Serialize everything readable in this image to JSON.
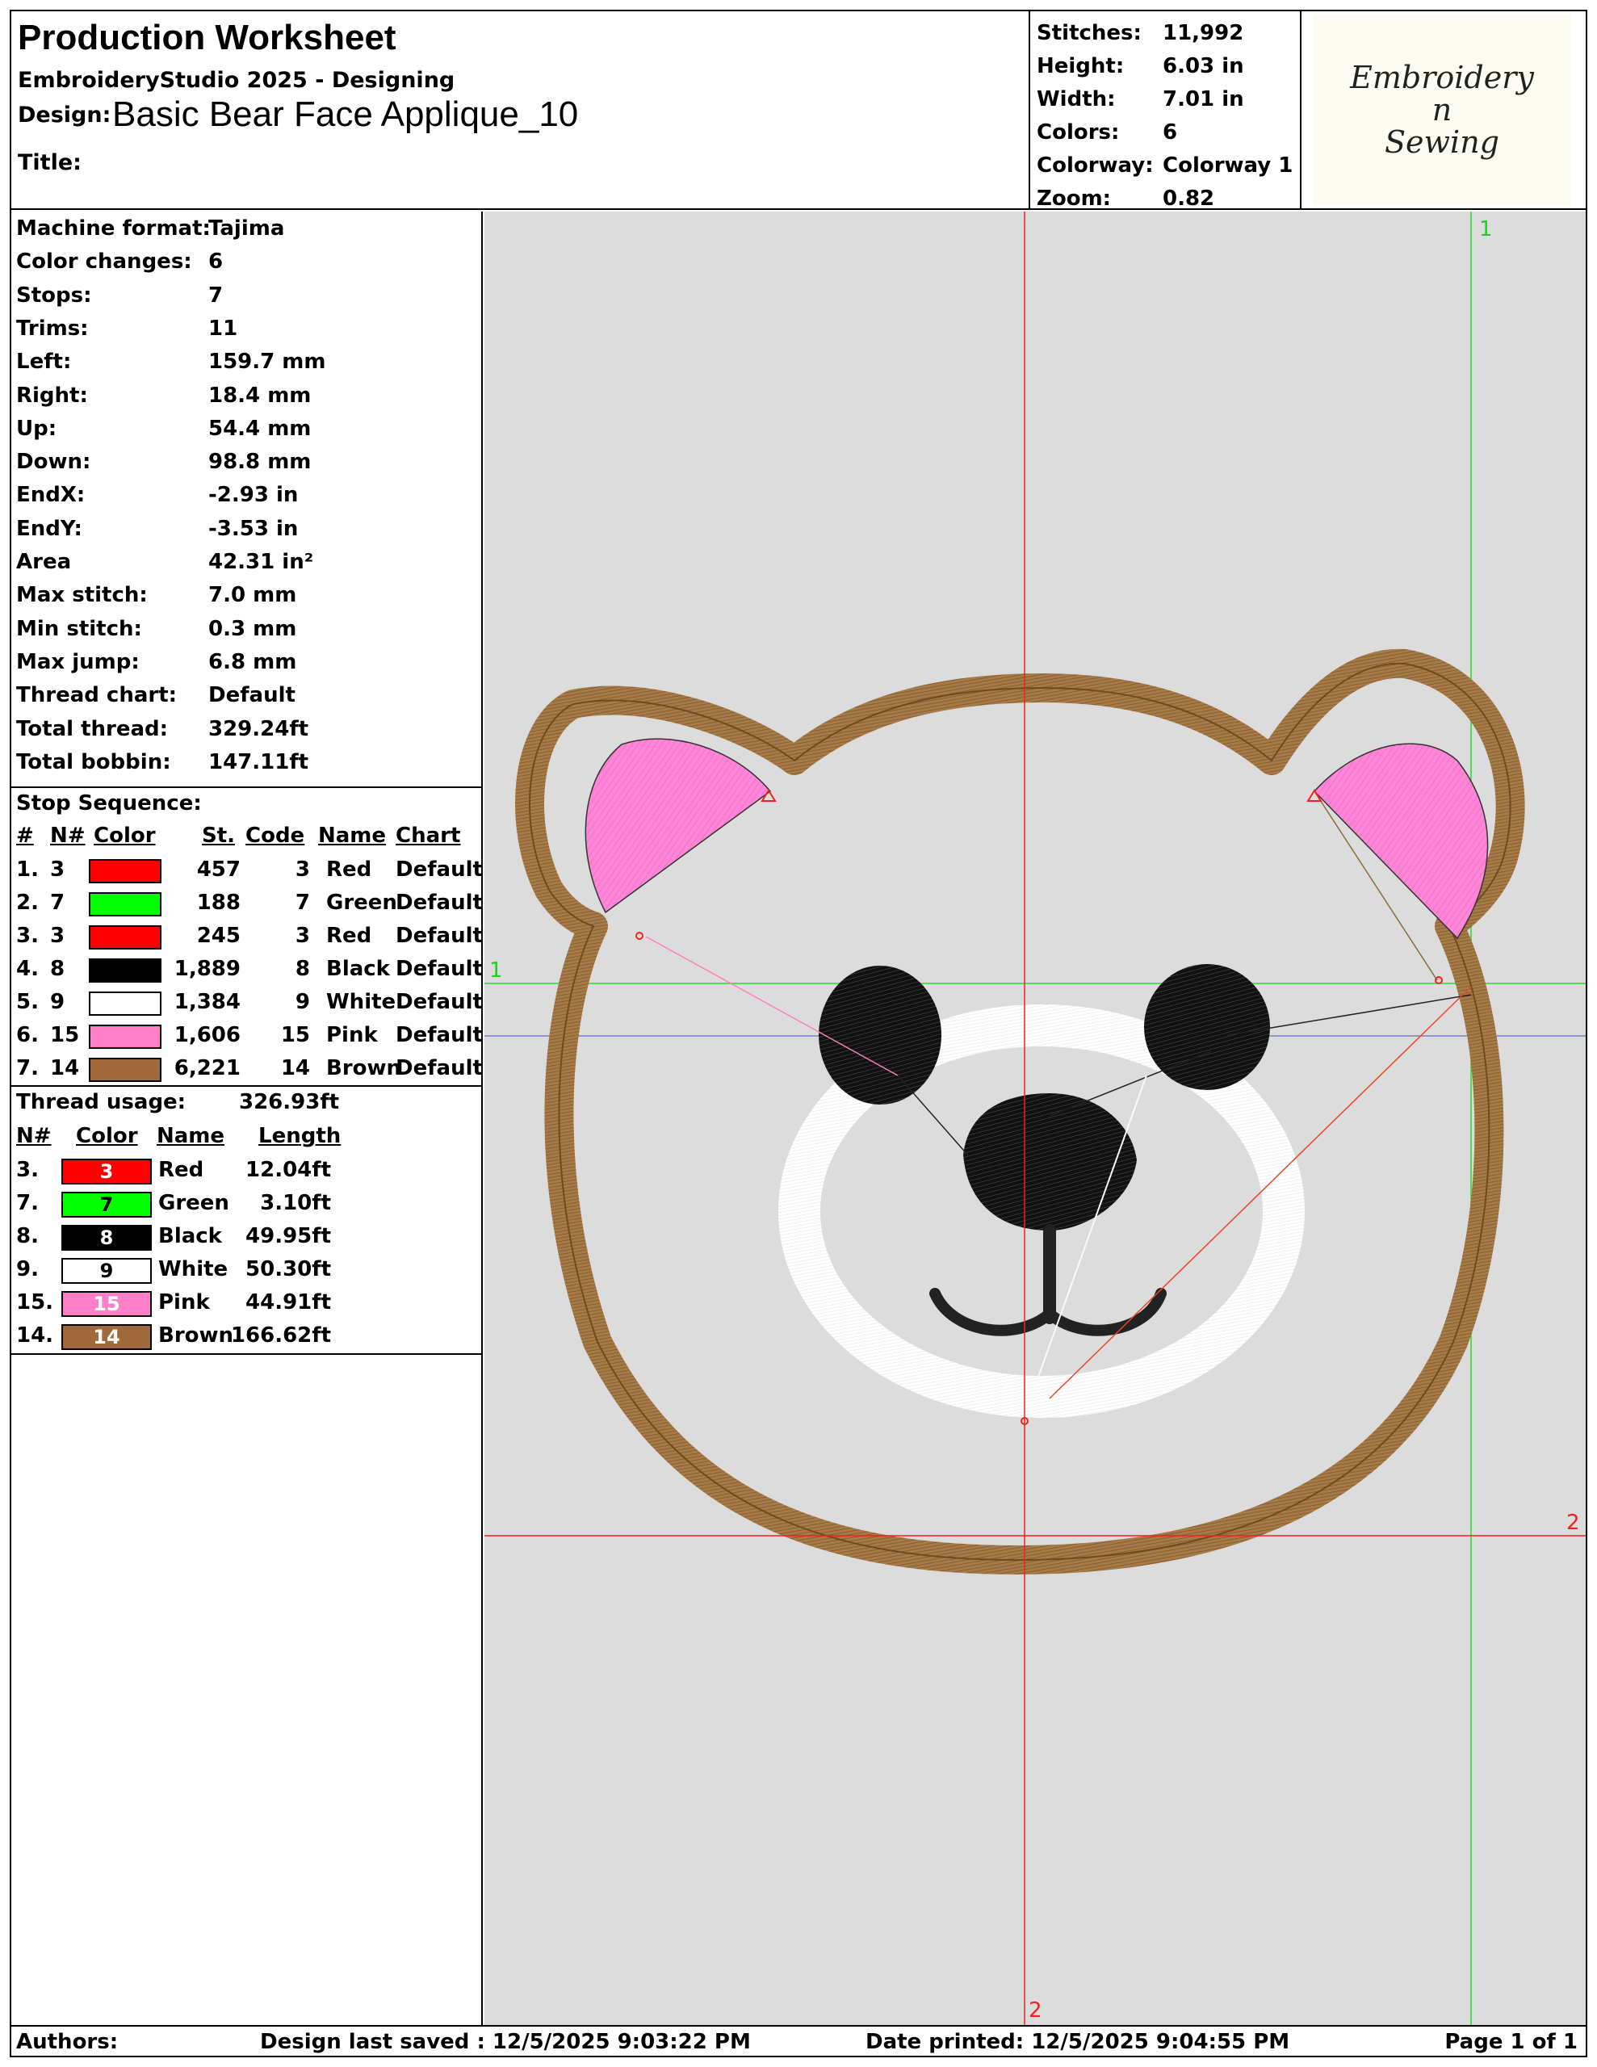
{
  "header": {
    "title": "Production Worksheet",
    "software": "EmbroideryStudio 2025 - Designing",
    "design_label": "Design:",
    "design_name": "Basic Bear Face Applique_10",
    "title_label": "Title:"
  },
  "stats": [
    {
      "label": "Stitches:",
      "value": "11,992"
    },
    {
      "label": "Height:",
      "value": "6.03 in"
    },
    {
      "label": "Width:",
      "value": "7.01 in"
    },
    {
      "label": "Colors:",
      "value": "6"
    },
    {
      "label": "Colorway:",
      "value": "Colorway 1"
    },
    {
      "label": "Zoom:",
      "value": "0.82"
    }
  ],
  "logo": {
    "line1": "Embroidery",
    "line2": "n",
    "line3": "Sewing"
  },
  "machine_info": [
    {
      "label": "Machine format:",
      "value": "Tajima"
    },
    {
      "label": "Color changes:",
      "value": "6"
    },
    {
      "label": "Stops:",
      "value": "7"
    },
    {
      "label": "Trims:",
      "value": "11"
    },
    {
      "label": "Left:",
      "value": "159.7 mm"
    },
    {
      "label": "Right:",
      "value": "18.4 mm"
    },
    {
      "label": "Up:",
      "value": "54.4 mm"
    },
    {
      "label": "Down:",
      "value": "98.8 mm"
    },
    {
      "label": "EndX:",
      "value": "-2.93 in"
    },
    {
      "label": "EndY:",
      "value": "-3.53 in"
    },
    {
      "label": "Area",
      "value": " 42.31 in²"
    },
    {
      "label": "Max stitch:",
      "value": "7.0 mm"
    },
    {
      "label": "Min stitch:",
      "value": "0.3 mm"
    },
    {
      "label": "Max jump:",
      "value": "6.8 mm"
    },
    {
      "label": "Thread chart:",
      "value": "Default"
    },
    {
      "label": "Total thread:",
      "value": "329.24ft"
    },
    {
      "label": "Total bobbin:",
      "value": "147.11ft"
    }
  ],
  "stop_sequence": {
    "title": "Stop Sequence:",
    "headers": {
      "idx": "#",
      "num": "N#",
      "color": "Color",
      "st": "St.",
      "code": "Code",
      "name": "Name",
      "chart": "Chart"
    },
    "rows": [
      {
        "idx": "1.",
        "num": "3",
        "hex": "#ff0000",
        "st": "457",
        "code": "3",
        "name": "Red",
        "chart": "Default"
      },
      {
        "idx": "2.",
        "num": "7",
        "hex": "#00ff00",
        "st": "188",
        "code": "7",
        "name": "Green",
        "chart": "Default"
      },
      {
        "idx": "3.",
        "num": "3",
        "hex": "#ff0000",
        "st": "245",
        "code": "3",
        "name": "Red",
        "chart": "Default"
      },
      {
        "idx": "4.",
        "num": "8",
        "hex": "#000000",
        "st": "1,889",
        "code": "8",
        "name": "Black",
        "chart": "Default"
      },
      {
        "idx": "5.",
        "num": "9",
        "hex": "#ffffff",
        "st": "1,384",
        "code": "9",
        "name": "White",
        "chart": "Default"
      },
      {
        "idx": "6.",
        "num": "15",
        "hex": "#ff80c8",
        "st": "1,606",
        "code": "15",
        "name": "Pink",
        "chart": "Default"
      },
      {
        "idx": "7.",
        "num": "14",
        "hex": "#a0693c",
        "st": "6,221",
        "code": "14",
        "name": "Brown",
        "chart": "Default"
      }
    ]
  },
  "thread_usage": {
    "title": "Thread usage:",
    "total": "326.93ft",
    "headers": {
      "num": "N#",
      "color": "Color",
      "name": "Name",
      "length": "Length"
    },
    "rows": [
      {
        "num": "3.",
        "code": "3",
        "hex": "#ff0000",
        "text_hex": "#ffffff",
        "name": "Red",
        "length": "12.04ft"
      },
      {
        "num": "7.",
        "code": "7",
        "hex": "#00ff00",
        "text_hex": "#000000",
        "name": "Green",
        "length": "3.10ft"
      },
      {
        "num": "8.",
        "code": "8",
        "hex": "#000000",
        "text_hex": "#ffffff",
        "name": "Black",
        "length": "49.95ft"
      },
      {
        "num": "9.",
        "code": "9",
        "hex": "#ffffff",
        "text_hex": "#000000",
        "name": "White",
        "length": "50.30ft"
      },
      {
        "num": "15.",
        "code": "15",
        "hex": "#ff80c8",
        "text_hex": "#ffffff",
        "name": "Pink",
        "length": "44.91ft"
      },
      {
        "num": "14.",
        "code": "14",
        "hex": "#a0693c",
        "text_hex": "#ffffff",
        "name": "Brown",
        "length": "166.62ft"
      }
    ]
  },
  "canvas": {
    "background": "#dcdcdc",
    "guide_labels": {
      "green_v": "1",
      "green_h": "1",
      "red_h": "2",
      "red_v": "2"
    }
  },
  "footer": {
    "authors_label": "Authors:",
    "saved": "Design last saved : 12/5/2025 9:03:22 PM",
    "printed": "Date printed: 12/5/2025 9:04:55 PM",
    "page": "Page 1 of 1"
  }
}
